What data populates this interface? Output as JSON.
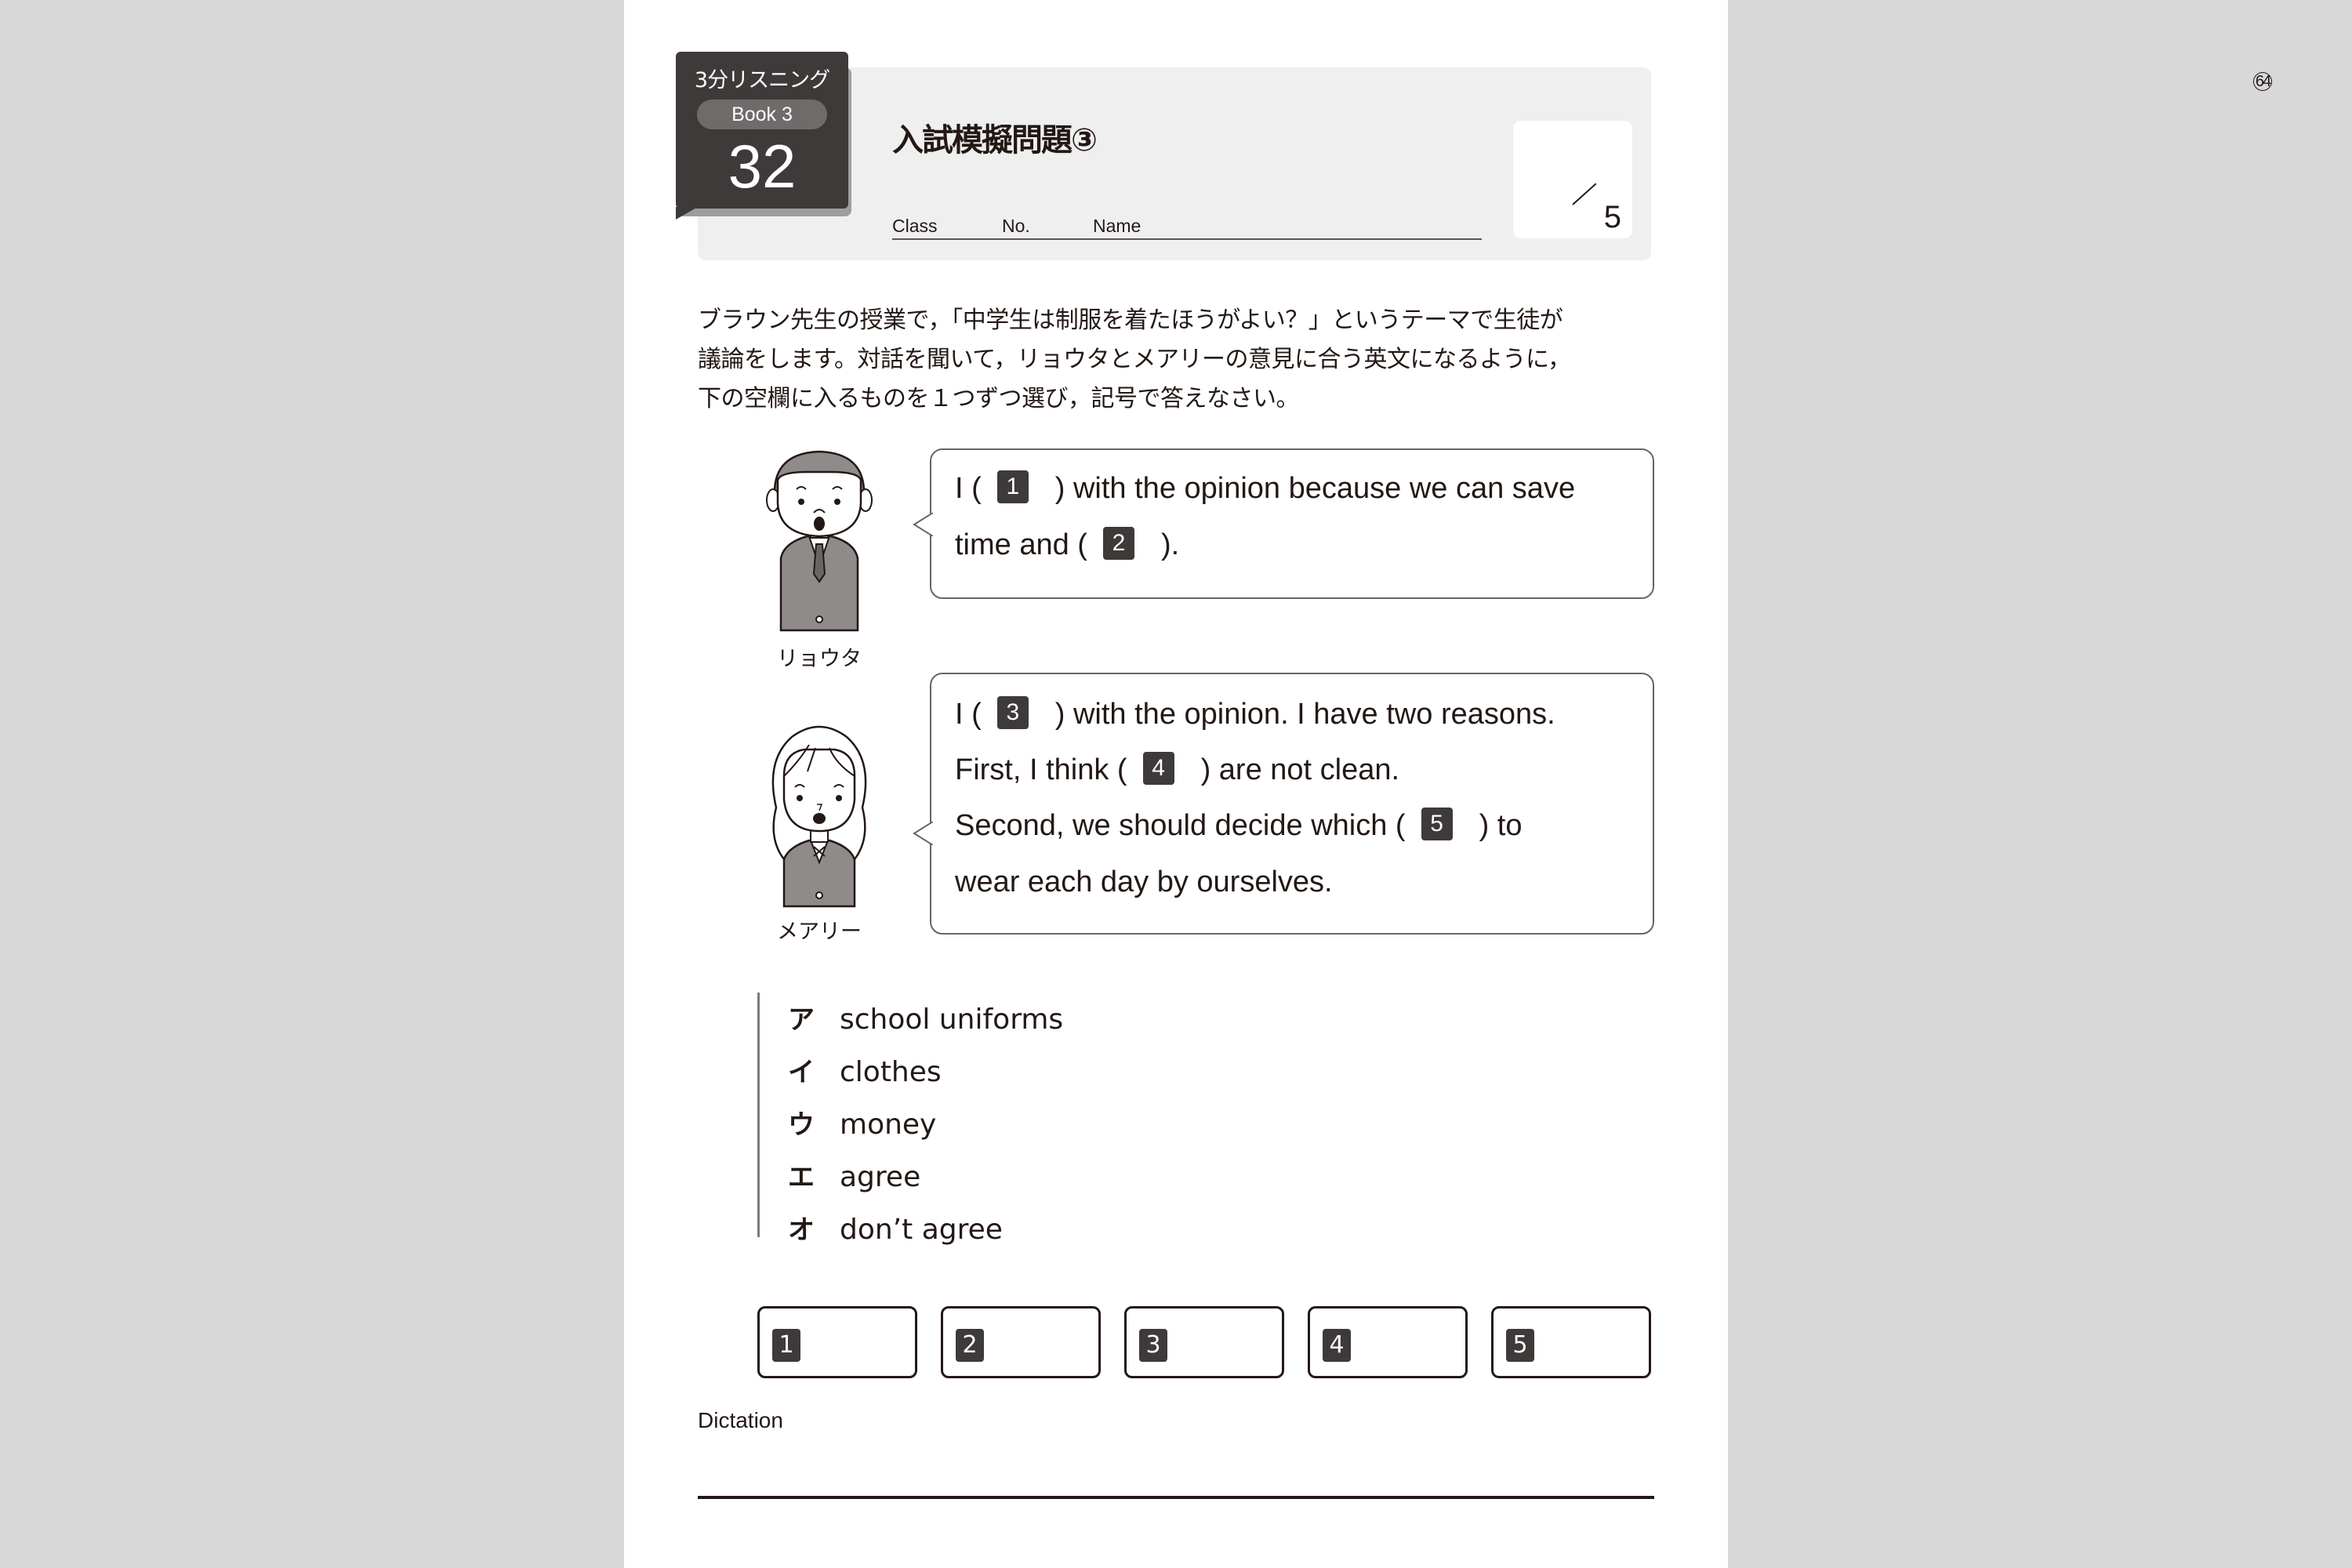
{
  "header": {
    "series": "3分リスニング",
    "book": "Book 3",
    "unit_number": "32",
    "title": "入試模擬問題③",
    "track_number": "64",
    "fields": [
      "Class",
      "No.",
      "Name"
    ],
    "score_total": "5"
  },
  "instructions": "ブラウン先生の授業で，「中学生は制服を着たほうがよい？」というテーマで生徒が議論をします。対話を聞いて，リョウタとメアリーの意見に合う英文になるように，下の空欄に入るものを１つずつ選び，記号で答えなさい。",
  "instructions_lines": [
    "ブラウン先生の授業で，「中学生は制服を着たほうがよい？」というテーマで生徒が",
    "議論をします。対話を聞いて，リョウタとメアリーの意見に合う英文になるように，",
    "下の空欄に入るものを１つずつ選び，記号で答えなさい。"
  ],
  "dialogue": [
    {
      "speaker": "リョウタ",
      "avatar": "boy-in-uniform-icon",
      "lines": [
        {
          "before": "I (",
          "blank": "1",
          "after": ") with the opinion because we can save"
        },
        {
          "before": "time and (",
          "blank": "2",
          "after": ")."
        }
      ]
    },
    {
      "speaker": "メアリー",
      "avatar": "girl-in-uniform-icon",
      "lines": [
        {
          "before": "I (",
          "blank": "3",
          "after": ") with the opinion.  I have two reasons."
        },
        {
          "before": "First, I think (",
          "blank": "4",
          "after": ") are not clean."
        },
        {
          "before": "Second, we should decide which (",
          "blank": "5",
          "after": ") to"
        },
        {
          "before": "wear each day by ourselves.",
          "blank": null,
          "after": ""
        }
      ]
    }
  ],
  "choices": [
    {
      "key": "ア",
      "text": "school uniforms"
    },
    {
      "key": "イ",
      "text": "clothes"
    },
    {
      "key": "ウ",
      "text": "money"
    },
    {
      "key": "エ",
      "text": "agree"
    },
    {
      "key": "オ",
      "text": "don’t agree"
    }
  ],
  "answer_boxes": [
    {
      "label": "1",
      "value": ""
    },
    {
      "label": "2",
      "value": ""
    },
    {
      "label": "3",
      "value": ""
    },
    {
      "label": "4",
      "value": ""
    },
    {
      "label": "5",
      "value": ""
    }
  ],
  "dictation": {
    "label": "Dictation",
    "value": ""
  }
}
